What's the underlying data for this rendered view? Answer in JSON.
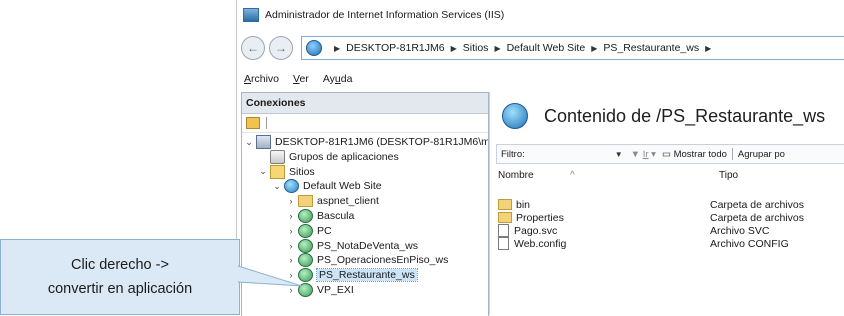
{
  "window": {
    "title": "Administrador de Internet Information Services (IIS)"
  },
  "address_bar": {
    "segments": [
      "DESKTOP-81R1JM6",
      "Sitios",
      "Default Web Site",
      "PS_Restaurante_ws"
    ]
  },
  "menu": {
    "items": [
      {
        "label": "Archivo",
        "mnemonic": "A"
      },
      {
        "label": "Ver",
        "mnemonic": "V"
      },
      {
        "label": "Ayuda",
        "mnemonic": "u"
      }
    ]
  },
  "connections": {
    "header": "Conexiones",
    "tree": [
      {
        "label": "DESKTOP-81R1JM6 (DESKTOP-81R1JM6\\m",
        "icon": "server-icon",
        "expander": "⌄",
        "level": 0
      },
      {
        "label": "Grupos de aplicaciones",
        "icon": "app-pool-icon",
        "expander": "",
        "level": 1
      },
      {
        "label": "Sitios",
        "icon": "sites-icon",
        "expander": "⌄",
        "level": 1
      },
      {
        "label": "Default Web Site",
        "icon": "website-icon",
        "expander": "⌄",
        "level": 2
      },
      {
        "label": "aspnet_client",
        "icon": "folder-icon",
        "expander": "›",
        "level": 3
      },
      {
        "label": "Bascula",
        "icon": "application-icon",
        "expander": "›",
        "level": 3
      },
      {
        "label": "PC",
        "icon": "application-icon",
        "expander": "›",
        "level": 3
      },
      {
        "label": "PS_NotaDeVenta_ws",
        "icon": "application-icon",
        "expander": "›",
        "level": 3
      },
      {
        "label": "PS_OperacionesEnPiso_ws",
        "icon": "application-icon",
        "expander": "›",
        "level": 3
      },
      {
        "label": "PS_Restaurante_ws",
        "icon": "application-icon",
        "expander": "›",
        "level": 3,
        "selected": true
      },
      {
        "label": "VP_EXI",
        "icon": "application-icon",
        "expander": "›",
        "level": 3
      }
    ]
  },
  "content": {
    "title": "Contenido de /PS_Restaurante_ws",
    "filter_label": "Filtro:",
    "go_label": "Ir",
    "show_all_label": "Mostrar todo",
    "group_by_label": "Agrupar po",
    "columns": [
      "Nombre",
      "Tipo"
    ],
    "rows": [
      {
        "name": "bin",
        "type": "Carpeta de archivos",
        "icon": "folder-icon"
      },
      {
        "name": "Properties",
        "type": "Carpeta de archivos",
        "icon": "folder-icon"
      },
      {
        "name": "Pago.svc",
        "type": "Archivo SVC",
        "icon": "file-icon"
      },
      {
        "name": "Web.config",
        "type": "Archivo CONFIG",
        "icon": "file-icon"
      }
    ]
  },
  "callout": {
    "line1": "Clic derecho ->",
    "line2": "convertir en aplicación"
  }
}
